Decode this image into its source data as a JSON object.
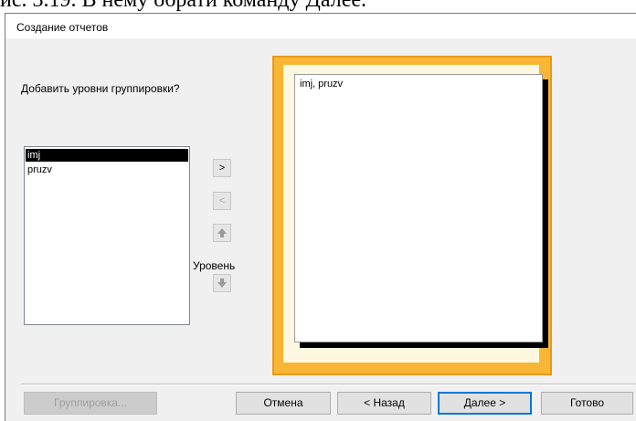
{
  "caption": "ис. 3.19. В нему обрати команду Далее.",
  "window": {
    "title": "Создание отчетов"
  },
  "prompt": "Добавить уровни группировки?",
  "fields": [
    {
      "label": "imj",
      "selected": true
    },
    {
      "label": "pruzv",
      "selected": false
    }
  ],
  "controls": {
    "add": ">",
    "remove": "<",
    "priority_label": "Уровень"
  },
  "preview": {
    "group_text": "imj, pruzv"
  },
  "buttons": {
    "grouping": "Группировка...",
    "cancel": "Отмена",
    "back": "< Назад",
    "next": "Далее >",
    "finish": "Готово"
  },
  "colors": {
    "preview_frame": "#f8b634",
    "default_button_border": "#0078d7"
  }
}
